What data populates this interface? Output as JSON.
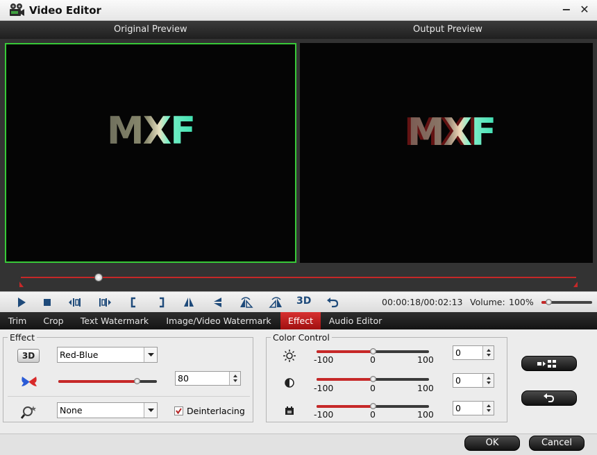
{
  "window": {
    "title": "Video Editor",
    "minimize_symbol": "−",
    "close_symbol": "✕",
    "icon": "film-camera-icon"
  },
  "preview": {
    "original_label": "Original Preview",
    "output_label": "Output Preview",
    "frame_text": "MXF",
    "selection_border_color": "#38c938"
  },
  "timeline": {
    "position_fraction": 0.14,
    "accent_color": "#c62828"
  },
  "controls": {
    "icons": [
      "play-icon",
      "stop-icon",
      "previous-frame-icon",
      "next-frame-icon",
      "set-start-icon",
      "set-end-icon",
      "flip-horizontal-icon",
      "flip-vertical-icon",
      "rotate-left-icon",
      "rotate-right-icon",
      "3d-icon",
      "undo-icon"
    ],
    "three_d_label": "3D",
    "time": "00:00:18/00:02:13",
    "volume_label": "Volume:",
    "volume_value": "100%",
    "volume_fraction": 0.15
  },
  "tabs": [
    {
      "label": "Trim",
      "active": false
    },
    {
      "label": "Crop",
      "active": false
    },
    {
      "label": "Text Watermark",
      "active": false
    },
    {
      "label": "Image/Video Watermark",
      "active": false
    },
    {
      "label": "Effect",
      "active": true
    },
    {
      "label": "Audio Editor",
      "active": false
    }
  ],
  "effect": {
    "group_title": "Effect",
    "three_d_badge": "3D",
    "three_d_mode": "Red-Blue",
    "depth_value": "80",
    "depth_fraction": 0.8,
    "filter_value": "None",
    "deinterlacing_label": "Deinterlacing",
    "deinterlacing_checked": true
  },
  "color_control": {
    "group_title": "Color Control",
    "rows": [
      {
        "icon": "brightness-icon",
        "min": "-100",
        "mid": "0",
        "max": "100",
        "value": "0"
      },
      {
        "icon": "contrast-icon",
        "min": "-100",
        "mid": "0",
        "max": "100",
        "value": "0"
      },
      {
        "icon": "saturation-icon",
        "min": "-100",
        "mid": "0",
        "max": "100",
        "value": "0"
      }
    ]
  },
  "side_buttons": {
    "apply_to_all_icon": "apply-to-all-icon",
    "reset_icon": "reset-icon"
  },
  "footer": {
    "ok_label": "OK",
    "cancel_label": "Cancel"
  }
}
